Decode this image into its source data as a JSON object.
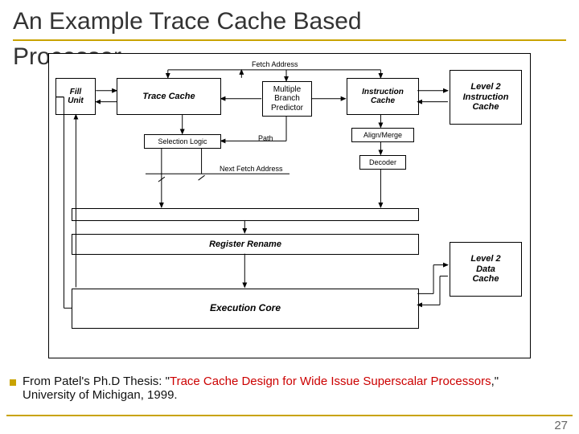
{
  "slide": {
    "title_line1": "An Example Trace Cache Based",
    "title_line2": "Processor",
    "page_number": "27"
  },
  "diagram": {
    "boxes": {
      "fill_unit": "Fill\nUnit",
      "trace_cache": "Trace Cache",
      "selection_logic": "Selection Logic",
      "branch_predictor": "Multiple\nBranch\nPredictor",
      "instruction_cache": "Instruction\nCache",
      "l2_icache": "Level 2\nInstruction\nCache",
      "align_merge": "Align/Merge",
      "decoder": "Decoder",
      "register_rename": "Register Rename",
      "execution_core": "Execution Core",
      "l2_dcache": "Level 2\nData\nCache"
    },
    "labels": {
      "fetch_address": "Fetch Address",
      "path": "Path",
      "next_fetch_address": "Next Fetch Address"
    }
  },
  "citation": {
    "prefix": "From Patel's Ph.D Thesis: \"",
    "linked": "Trace Cache Design for Wide Issue Superscalar Processors",
    "suffix": ",\" University of Michigan, 1999."
  }
}
